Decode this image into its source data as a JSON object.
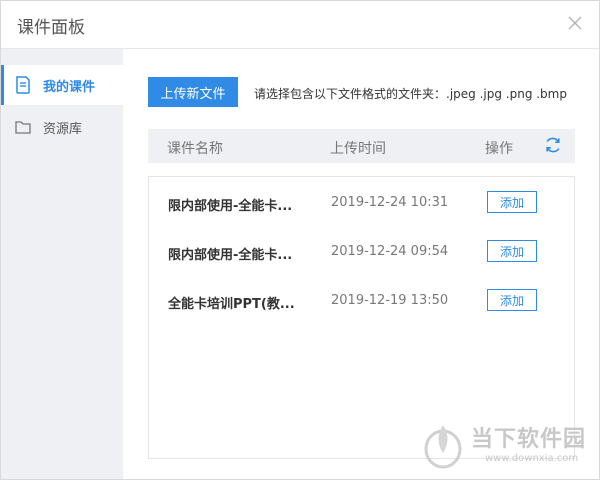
{
  "window": {
    "title": "课件面板"
  },
  "sidebar": {
    "items": [
      {
        "label": "我的课件",
        "icon": "document-icon",
        "active": true
      },
      {
        "label": "资源库",
        "icon": "folder-icon",
        "active": false
      }
    ]
  },
  "toolbar": {
    "upload_label": "上传新文件",
    "hint": "请选择包含以下文件格式的文件夹：.jpeg .jpg .png .bmp"
  },
  "table": {
    "columns": [
      "课件名称",
      "上传时间",
      "操作"
    ],
    "rows": [
      {
        "name": "限内部使用-全能卡...",
        "time": "2019-12-24 10:31",
        "action": "添加"
      },
      {
        "name": "限内部使用-全能卡...",
        "time": "2019-12-24 09:54",
        "action": "添加"
      },
      {
        "name": "全能卡培训PPT(教...",
        "time": "2019-12-19 13:50",
        "action": "添加"
      }
    ]
  },
  "watermark": {
    "text": "当下软件园",
    "url": "www.downxia.com"
  },
  "colors": {
    "accent": "#2f8be6",
    "sidebar_bg": "#eef0f4"
  }
}
